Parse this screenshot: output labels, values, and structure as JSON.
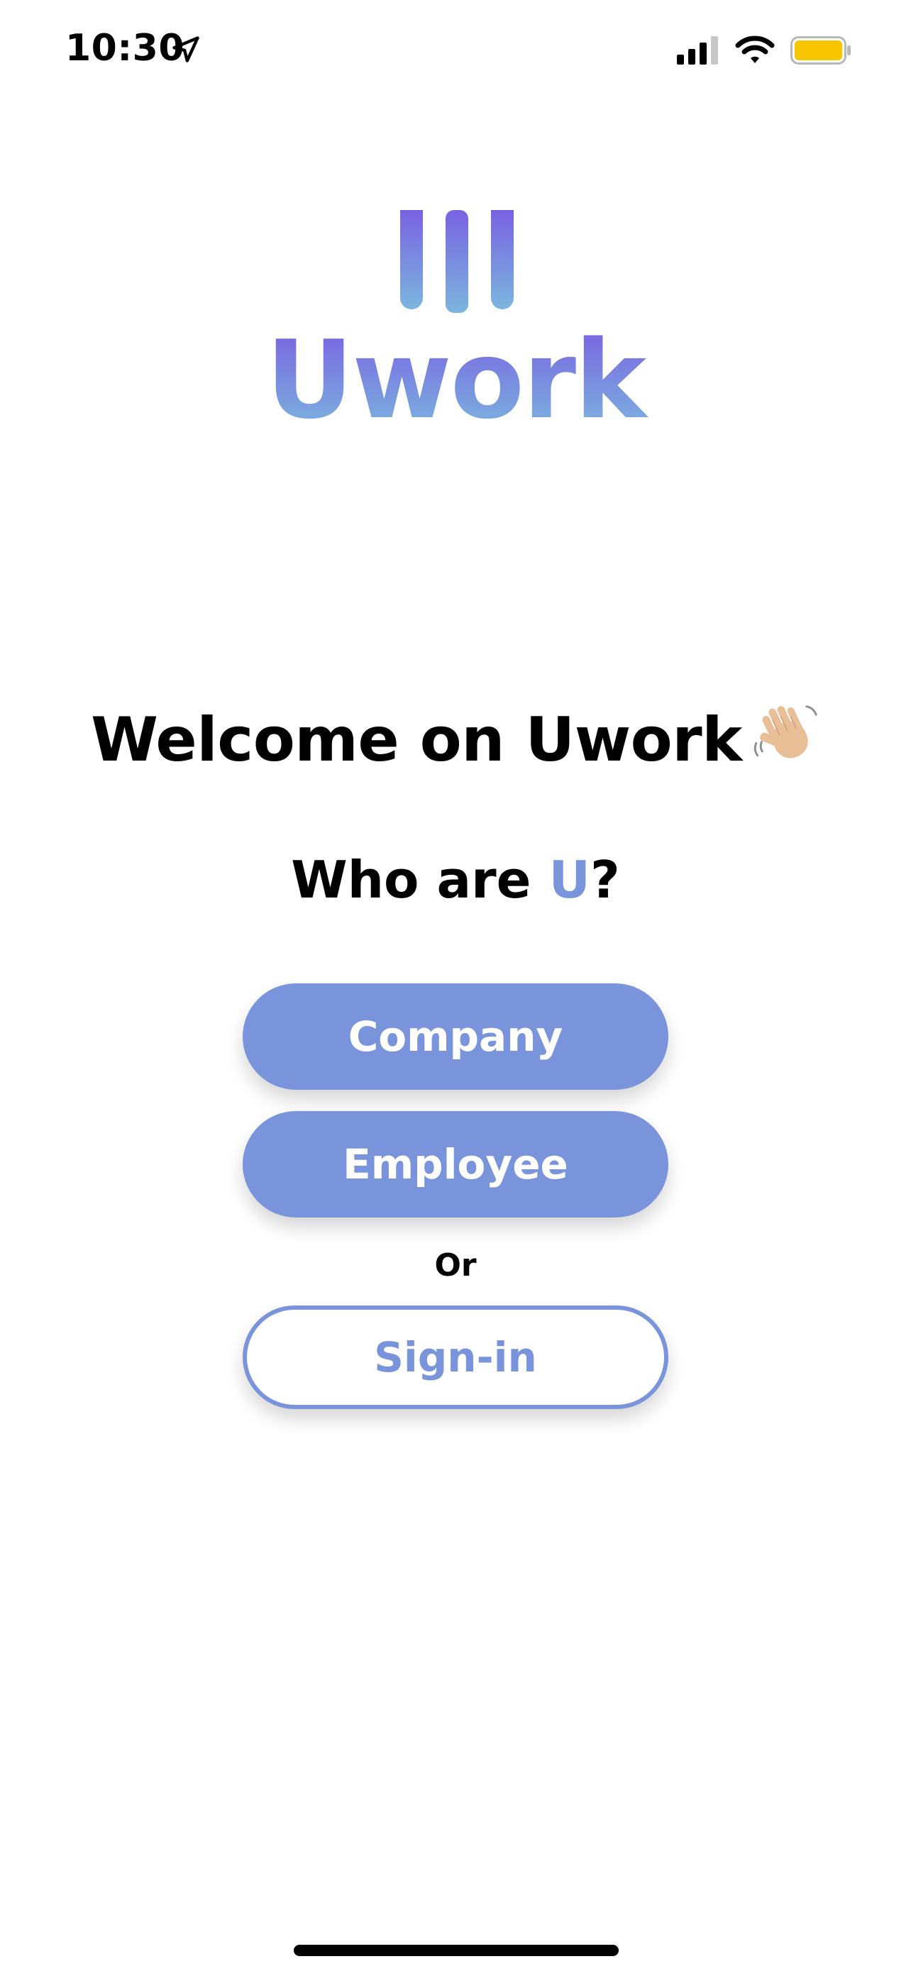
{
  "status_bar": {
    "time": "10:30",
    "icons": [
      "location-arrow-icon",
      "cellular-signal-icon",
      "wifi-icon",
      "battery-icon"
    ],
    "battery_color": "#f7c600"
  },
  "brand": {
    "logo_icon": "uwork-bars-logo",
    "name": "Uwork",
    "gradient": [
      "#7a62e2",
      "#7bb6de"
    ]
  },
  "welcome": {
    "title": "Welcome on Uwork",
    "emoji_icon": "waving-hand-icon"
  },
  "question": {
    "prefix": "Who are ",
    "accent": "U",
    "suffix": "?"
  },
  "buttons": {
    "company_label": "Company",
    "employee_label": "Employee",
    "or_label": "Or",
    "signin_label": "Sign-in"
  },
  "colors": {
    "accent": "#7a94dc",
    "text": "#000000",
    "background": "#ffffff"
  }
}
